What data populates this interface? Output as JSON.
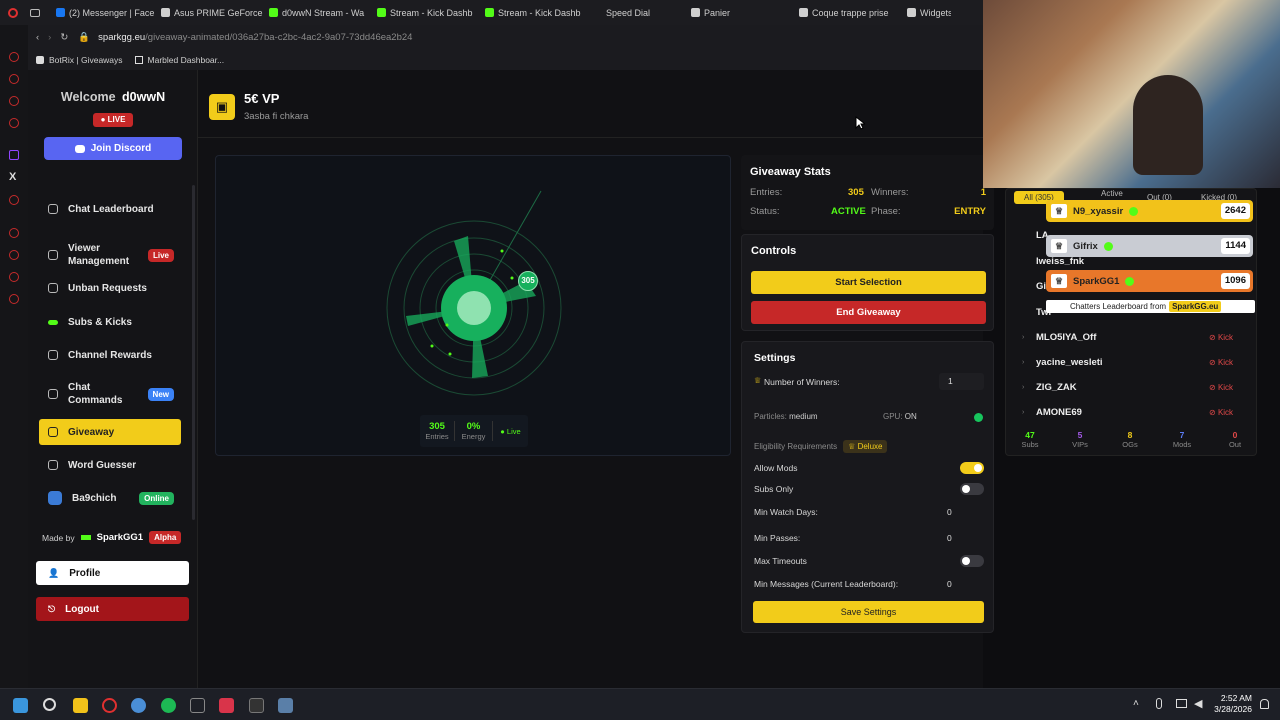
{
  "browser": {
    "tabs": [
      {
        "label": "(2) Messenger | Face",
        "icon": "facebook-icon",
        "color": "#1877f2"
      },
      {
        "label": "Asus PRIME GeForce",
        "icon": "asus-icon",
        "color": "#cfcfcf"
      },
      {
        "label": "d0wwN Stream - Wa",
        "icon": "kick-icon",
        "color": "#53fc18"
      },
      {
        "label": "Stream - Kick Dashb",
        "icon": "kick-icon",
        "color": "#53fc18"
      },
      {
        "label": "Stream - Kick Dashb",
        "icon": "kick-icon",
        "color": "#53fc18"
      },
      {
        "label": "Speed Dial",
        "icon": "blank-icon",
        "color": "#1c1c20"
      },
      {
        "label": "Panier",
        "icon": "cart-icon",
        "color": "#cfcfcf"
      },
      {
        "label": "Coque trappe prise",
        "icon": "cart-icon",
        "color": "#cfcfcf"
      },
      {
        "label": "Widgets |",
        "icon": "widget-icon",
        "color": "#cfcfcf"
      }
    ],
    "url_host": "sparkgg.eu",
    "url_path": "/giveaway-animated/036a27ba-c2bc-4ac2-9a07-73dd46ea2b24",
    "bookmarks": [
      "BotRix | Giveaways",
      "Marbled Dashboar..."
    ]
  },
  "sidebar": {
    "welcome": "Welcome",
    "username": "d0wwN",
    "live_badge": "LIVE",
    "join_discord": "Join Discord",
    "items": [
      {
        "label": "Chat Leaderboard",
        "icon": "trophy-icon"
      },
      {
        "label": "Viewer Management",
        "icon": "users-icon",
        "badge": "Live"
      },
      {
        "label": "Unban Requests",
        "icon": "shield-icon"
      },
      {
        "label": "Subs & Kicks",
        "icon": "kick-icon"
      },
      {
        "label": "Channel Rewards",
        "icon": "medal-icon"
      },
      {
        "label": "Chat Commands",
        "icon": "command-icon",
        "badge": "New"
      },
      {
        "label": "Giveaway",
        "icon": "gift-icon"
      },
      {
        "label": "Word Guesser",
        "icon": "text-icon"
      },
      {
        "label": "Ba9chich",
        "icon": "coin-icon",
        "badge": "Online"
      }
    ],
    "made_by": "Made by",
    "author": "SparkGG1",
    "alpha": "Alpha",
    "profile": "Profile",
    "logout": "Logout"
  },
  "header": {
    "title": "5€ VP",
    "subtitle": "3asba fi chkara"
  },
  "radar": {
    "count_bubble": "305",
    "entries_value": "305",
    "entries_label": "Entries",
    "energy_value": "0%",
    "energy_label": "Energy",
    "live_label": "Live"
  },
  "stats": {
    "title": "Giveaway Stats",
    "entries_label": "Entries:",
    "entries_value": "305",
    "winners_label": "Winners:",
    "winners_value": "1",
    "status_label": "Status:",
    "status_value": "ACTIVE",
    "phase_label": "Phase:",
    "phase_value": "ENTRY"
  },
  "controls": {
    "title": "Controls",
    "start": "Start Selection",
    "end": "End Giveaway"
  },
  "settings": {
    "title": "Settings",
    "num_winners_label": "Number of Winners:",
    "num_winners_value": "1",
    "particles_label": "Particles:",
    "particles_value": "medium",
    "gpu_label": "GPU:",
    "gpu_value": "ON",
    "eligibility_label": "Eligibility Requirements",
    "deluxe": "Deluxe",
    "allow_mods": "Allow Mods",
    "allow_mods_on": true,
    "subs_only": "Subs Only",
    "subs_only_on": false,
    "min_watch_days": "Min Watch Days:",
    "min_watch_days_value": "0",
    "min_passes": "Min Passes:",
    "min_passes_value": "0",
    "max_timeouts": "Max Timeouts",
    "max_timeouts_on": false,
    "min_messages": "Min Messages (Current Leaderboard):",
    "min_messages_value": "0",
    "save": "Save Settings"
  },
  "viewers": {
    "tabs": [
      "All (305)",
      "Active",
      "Out (0)",
      "Kicked (0)"
    ],
    "partial_rows": [
      "LA",
      "lweiss_fnk",
      "Gi",
      "Twi"
    ],
    "rows": [
      "MLO5IYA_Off",
      "yacine_wesleti",
      "ZIG_ZAK",
      "AMONE69"
    ],
    "kick_label": "Kick",
    "summary": [
      {
        "value": "47",
        "label": "Subs",
        "color": "#53fc18"
      },
      {
        "value": "5",
        "label": "VIPs",
        "color": "#a45ae8"
      },
      {
        "value": "8",
        "label": "OGs",
        "color": "#f2cc1a"
      },
      {
        "value": "7",
        "label": "Mods",
        "color": "#5b7cf5"
      },
      {
        "value": "0",
        "label": "Out",
        "color": "#e04848"
      }
    ]
  },
  "leaderboard_overlay": {
    "rows": [
      {
        "name": "N9_xyassir",
        "score": "2642",
        "bg": "#f2c21a"
      },
      {
        "name": "Gifrix",
        "score": "1144",
        "bg": "#c9ccd3"
      },
      {
        "name": "SparkGG1",
        "score": "1096",
        "bg": "#e8772a"
      }
    ],
    "footer_text": "Chatters Leaderboard from",
    "footer_brand": "SparkGG.eu"
  },
  "taskbar": {
    "time": "2:52 AM",
    "date": "3/28/2026"
  }
}
